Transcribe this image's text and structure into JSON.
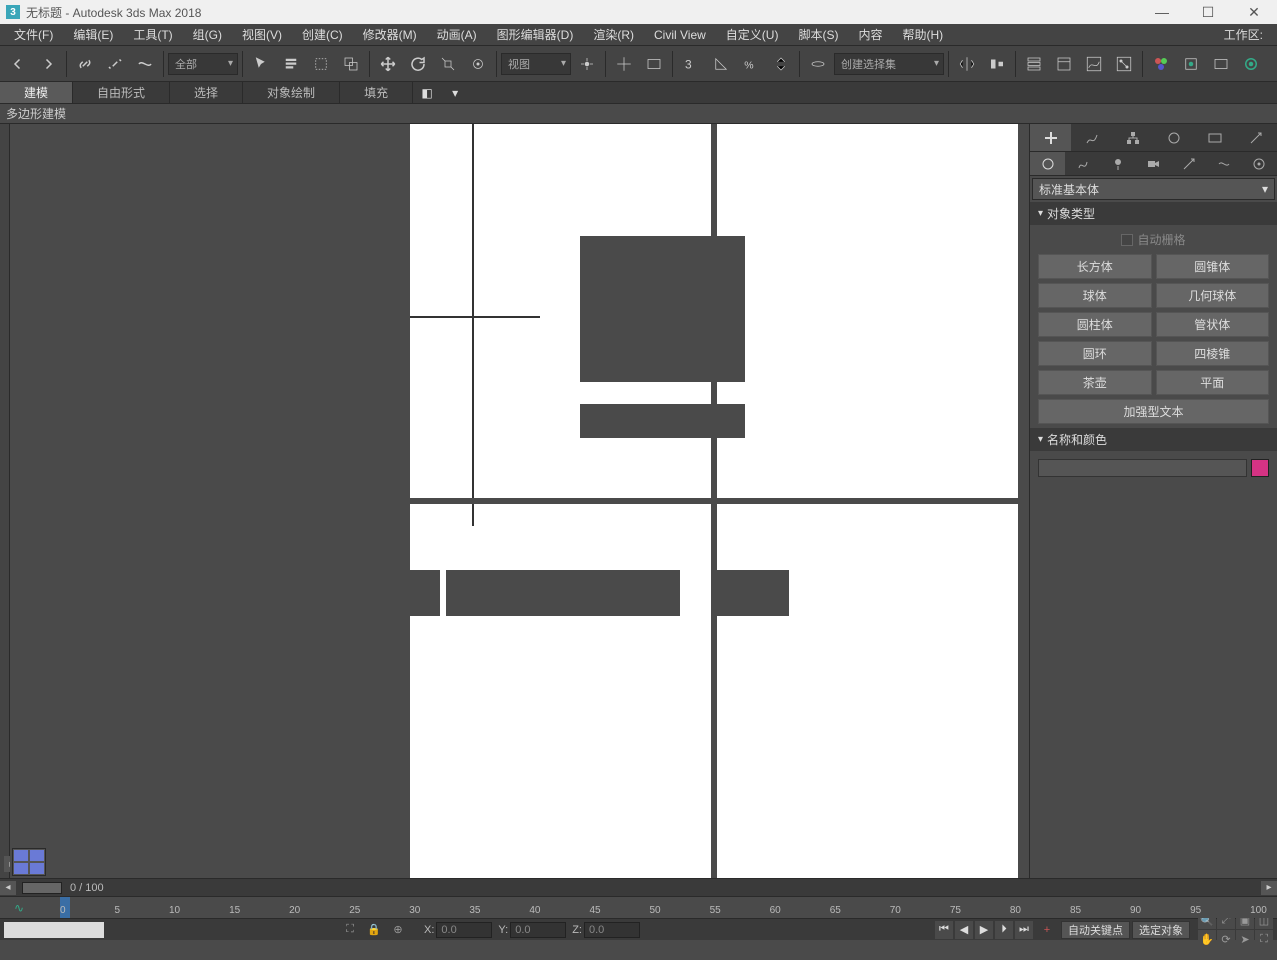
{
  "title": "无标题 - Autodesk 3ds Max 2018",
  "app_icon": "3",
  "window_buttons": {
    "min": "—",
    "max": "☐",
    "close": "✕"
  },
  "menu": [
    "文件(F)",
    "编辑(E)",
    "工具(T)",
    "组(G)",
    "视图(V)",
    "创建(C)",
    "修改器(M)",
    "动画(A)",
    "图形编辑器(D)",
    "渲染(R)",
    "Civil View",
    "自定义(U)",
    "脚本(S)",
    "内容",
    "帮助(H)",
    "工作区:"
  ],
  "toolbar": {
    "dropdown_all": "全部",
    "dropdown_view": "视图",
    "dropdown_selset": "创建选择集"
  },
  "ribbon": {
    "tabs": [
      "建模",
      "自由形式",
      "选择",
      "对象绘制",
      "填充"
    ],
    "active": 0,
    "sub": "多边形建模"
  },
  "right_panel": {
    "create_dropdown": "标准基本体",
    "section_obj": "对象类型",
    "autogrid": "自动栅格",
    "objects": [
      [
        "长方体",
        "圆锥体"
      ],
      [
        "球体",
        "几何球体"
      ],
      [
        "圆柱体",
        "管状体"
      ],
      [
        "圆环",
        "四棱锥"
      ],
      [
        "茶壶",
        "平面"
      ]
    ],
    "obj_wide": "加强型文本",
    "section_name": "名称和颜色"
  },
  "timeline": {
    "frame_label": "0 / 100",
    "ticks": [
      "0",
      "5",
      "10",
      "15",
      "20",
      "25",
      "30",
      "35",
      "40",
      "45",
      "50",
      "55",
      "60",
      "65",
      "70",
      "75",
      "80",
      "85",
      "90",
      "95",
      "100"
    ]
  },
  "status": {
    "x": "0.0",
    "y": "0.0",
    "z": "0.0",
    "x_lbl": "X:",
    "y_lbl": "Y:",
    "z_lbl": "Z:",
    "autokey": "自动关键点",
    "selobj": "选定对象"
  }
}
